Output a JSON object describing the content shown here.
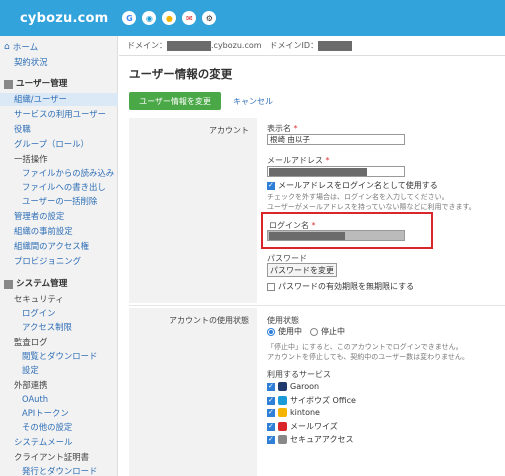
{
  "header": {
    "logo": "cybozu.com",
    "icons": [
      {
        "name": "google-icon",
        "glyph": "G",
        "color": "#4285f4"
      },
      {
        "name": "circle-app-icon",
        "glyph": "◉",
        "color": "#1a9ad6"
      },
      {
        "name": "chat-icon",
        "glyph": "●",
        "color": "#f5b400"
      },
      {
        "name": "mail-icon",
        "glyph": "✉",
        "color": "#d9262a"
      },
      {
        "name": "settings-icon",
        "glyph": "⚙",
        "color": "#333333"
      }
    ]
  },
  "sidebar": {
    "home": "ホーム",
    "contract": "契約状況",
    "user_section": "ユーザー管理",
    "user_items": [
      "組織/ユーザー",
      "サービスの利用ユーザー",
      "役職",
      "グループ（ロール）"
    ],
    "bulk": "一括操作",
    "bulk_items": [
      "ファイルからの読み込み",
      "ファイルへの書き出し",
      "ユーザーの一括削除"
    ],
    "user_items2": [
      "管理者の設定",
      "組織の事前設定",
      "組織間のアクセス権",
      "プロビジョニング"
    ],
    "system_section": "システム管理",
    "security": "セキュリティ",
    "security_items": [
      "ログイン",
      "アクセス制限"
    ],
    "audit": "監査ログ",
    "audit_items": [
      "閲覧とダウンロード",
      "設定"
    ],
    "external": "外部連携",
    "external_items": [
      "OAuth",
      "APIトークン",
      "その他の設定"
    ],
    "system_mail": "システムメール",
    "client_cert": "クライアント証明書",
    "cert_items": [
      "発行とダウンロード"
    ]
  },
  "topbar": {
    "domain_label": "ドメイン：",
    "domain_suffix": ".cybozu.com",
    "domain_id_label": "ドメインID："
  },
  "page": {
    "title": "ユーザー情報の変更",
    "save_button": "ユーザー情報を変更",
    "cancel": "キャンセル"
  },
  "account": {
    "section_label": "アカウント",
    "display_name_label": "表示名",
    "display_name_value": "根崎 由以子",
    "email_label": "メールアドレス",
    "use_email_login": "メールアドレスをログイン名として使用する",
    "hint1": "チェックを外す場合は、ログイン名を入力してください。",
    "hint2": "ユーザーがメールアドレスを持っていない際などに利用できます。",
    "login_name_label": "ログイン名",
    "password_label": "パスワード",
    "change_password_button": "パスワードを変更",
    "no_expiry": "パスワードの有効期限を無期限にする"
  },
  "usage": {
    "section_label": "アカウントの使用状態",
    "state_label": "使用状態",
    "in_use": "使用中",
    "suspended": "停止中",
    "note1": "「停止中」にすると、このアカウントでログインできません。",
    "note2": "アカウントを停止しても、契約中のユーザー数は変わりません。",
    "services_label": "利用するサービス",
    "services": [
      {
        "name": "Garoon",
        "color": "#1e3a6e"
      },
      {
        "name": "サイボウズ Office",
        "color": "#1a9ad6"
      },
      {
        "name": "kintone",
        "color": "#f5b400"
      },
      {
        "name": "メールワイズ",
        "color": "#d9262a"
      },
      {
        "name": "セキュアアクセス",
        "color": "#888888"
      }
    ]
  }
}
